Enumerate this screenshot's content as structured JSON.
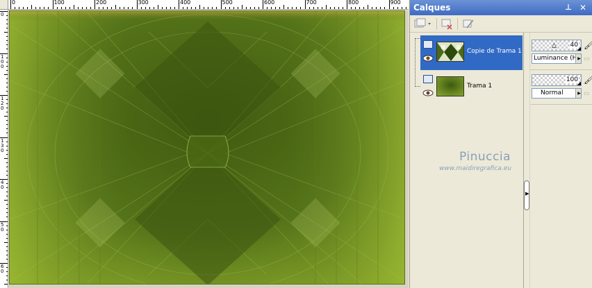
{
  "ruler": {
    "top_labels": [
      "0",
      "100",
      "200",
      "300",
      "400",
      "500",
      "600",
      "700",
      "800",
      "900"
    ],
    "left_labels": [
      "0",
      "1\n0\n0",
      "1\n2\n0",
      "1\n3\n0",
      "4\n0",
      "5\n0",
      "6\n0"
    ]
  },
  "panel": {
    "title": "Calques",
    "pin_icon": "pin-icon",
    "close_icon": "close-icon"
  },
  "layers": [
    {
      "name": "Copie de Trama 1",
      "selected": true
    },
    {
      "name": "Trama 1",
      "selected": false
    }
  ],
  "properties": {
    "opacity_top": "40",
    "blend_top": "Luminance (H)",
    "opacity_bottom": "100",
    "blend_bottom": "Normal"
  },
  "watermark": {
    "name": "Pinuccia",
    "url": "www.maidiregrafica.eu"
  },
  "colors": {
    "canvas_dark": "#4f6b17",
    "canvas_light": "#8aa62a",
    "selection": "#316ac5",
    "title_bar": "#4f7bcf"
  }
}
